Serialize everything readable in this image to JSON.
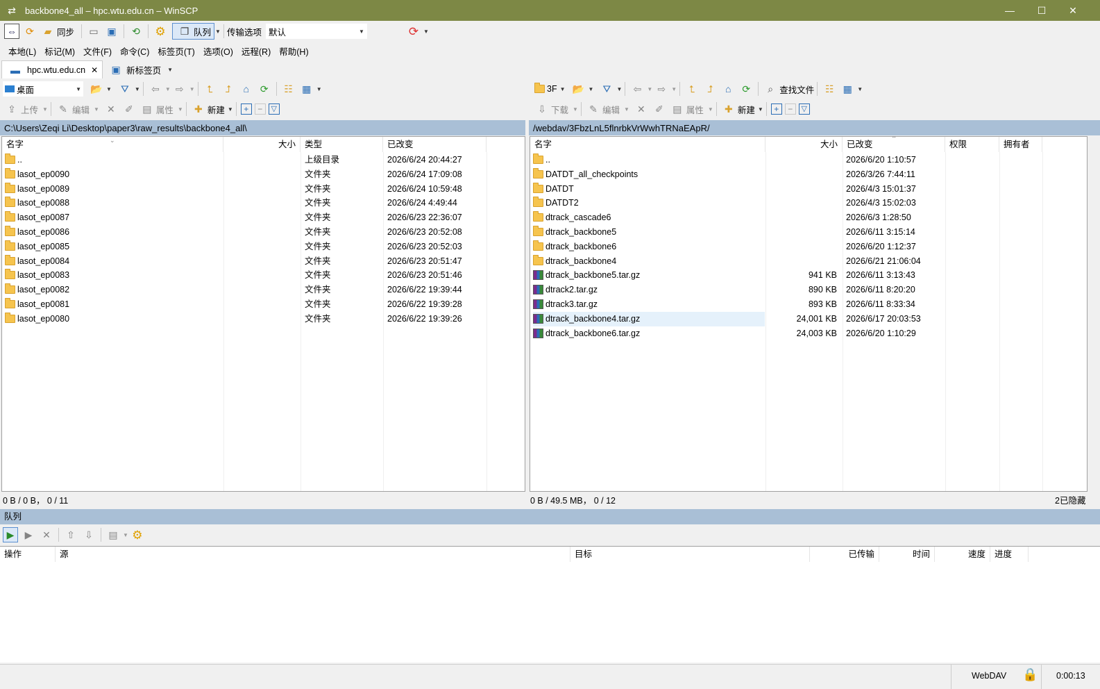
{
  "window": {
    "title": "backbone4_all – hpc.wtu.edu.cn – WinSCP",
    "minimize": "—",
    "maximize": "☐",
    "close": "✕"
  },
  "toolbar": {
    "sync_label": "同步",
    "queue_label": "队列",
    "transfer_label": "传输选项",
    "transfer_value": "默认"
  },
  "menu": [
    "本地(L)",
    "标记(M)",
    "文件(F)",
    "命令(C)",
    "标签页(T)",
    "选项(O)",
    "远程(R)",
    "帮助(H)"
  ],
  "tabs": {
    "session": "hpc.wtu.edu.cn",
    "close": "✕",
    "new_tab": "新标签页"
  },
  "local": {
    "location": "桌面",
    "actions": {
      "upload": "上传",
      "edit": "编辑",
      "properties": "属性",
      "new": "新建"
    },
    "path": "C:\\Users\\Zeqi Li\\Desktop\\paper3\\raw_results\\backbone4_all\\",
    "columns": {
      "name": "名字",
      "size": "大小",
      "type": "类型",
      "changed": "已改变"
    },
    "files": [
      {
        "name": "..",
        "size": "",
        "type": "上级目录",
        "changed": "2026/6/24 20:44:27",
        "kind": "parent"
      },
      {
        "name": "lasot_ep0090",
        "size": "",
        "type": "文件夹",
        "changed": "2026/6/24 17:09:08",
        "kind": "folder"
      },
      {
        "name": "lasot_ep0089",
        "size": "",
        "type": "文件夹",
        "changed": "2026/6/24 10:59:48",
        "kind": "folder"
      },
      {
        "name": "lasot_ep0088",
        "size": "",
        "type": "文件夹",
        "changed": "2026/6/24 4:49:44",
        "kind": "folder"
      },
      {
        "name": "lasot_ep0087",
        "size": "",
        "type": "文件夹",
        "changed": "2026/6/23 22:36:07",
        "kind": "folder"
      },
      {
        "name": "lasot_ep0086",
        "size": "",
        "type": "文件夹",
        "changed": "2026/6/23 20:52:08",
        "kind": "folder"
      },
      {
        "name": "lasot_ep0085",
        "size": "",
        "type": "文件夹",
        "changed": "2026/6/23 20:52:03",
        "kind": "folder"
      },
      {
        "name": "lasot_ep0084",
        "size": "",
        "type": "文件夹",
        "changed": "2026/6/23 20:51:47",
        "kind": "folder"
      },
      {
        "name": "lasot_ep0083",
        "size": "",
        "type": "文件夹",
        "changed": "2026/6/23 20:51:46",
        "kind": "folder"
      },
      {
        "name": "lasot_ep0082",
        "size": "",
        "type": "文件夹",
        "changed": "2026/6/22 19:39:44",
        "kind": "folder"
      },
      {
        "name": "lasot_ep0081",
        "size": "",
        "type": "文件夹",
        "changed": "2026/6/22 19:39:28",
        "kind": "folder"
      },
      {
        "name": "lasot_ep0080",
        "size": "",
        "type": "文件夹",
        "changed": "2026/6/22 19:39:26",
        "kind": "folder"
      }
    ],
    "status": "0 B / 0 B， 0 / 11"
  },
  "remote": {
    "location": "3F",
    "actions": {
      "download": "下载",
      "edit": "编辑",
      "properties": "属性",
      "new": "新建",
      "find": "查找文件"
    },
    "path": "/webdav/3FbzLnL5flnrbkVrWwhTRNaEApR/",
    "columns": {
      "name": "名字",
      "size": "大小",
      "changed": "已改变",
      "rights": "权限",
      "owner": "拥有者"
    },
    "files": [
      {
        "name": "..",
        "size": "",
        "changed": "2026/6/20 1:10:57",
        "kind": "parent"
      },
      {
        "name": "DATDT_all_checkpoints",
        "size": "",
        "changed": "2026/3/26 7:44:11",
        "kind": "folder"
      },
      {
        "name": "DATDT",
        "size": "",
        "changed": "2026/4/3 15:01:37",
        "kind": "folder"
      },
      {
        "name": "DATDT2",
        "size": "",
        "changed": "2026/4/3 15:02:03",
        "kind": "folder"
      },
      {
        "name": "dtrack_cascade6",
        "size": "",
        "changed": "2026/6/3 1:28:50",
        "kind": "folder"
      },
      {
        "name": "dtrack_backbone5",
        "size": "",
        "changed": "2026/6/11 3:15:14",
        "kind": "folder"
      },
      {
        "name": "dtrack_backbone6",
        "size": "",
        "changed": "2026/6/20 1:12:37",
        "kind": "folder"
      },
      {
        "name": "dtrack_backbone4",
        "size": "",
        "changed": "2026/6/21 21:06:04",
        "kind": "folder"
      },
      {
        "name": "dtrack_backbone5.tar.gz",
        "size": "941 KB",
        "changed": "2026/6/11 3:13:43",
        "kind": "archive"
      },
      {
        "name": "dtrack2.tar.gz",
        "size": "890 KB",
        "changed": "2026/6/11 8:20:20",
        "kind": "archive"
      },
      {
        "name": "dtrack3.tar.gz",
        "size": "893 KB",
        "changed": "2026/6/11 8:33:34",
        "kind": "archive"
      },
      {
        "name": "dtrack_backbone4.tar.gz",
        "size": "24,001 KB",
        "changed": "2026/6/17 20:03:53",
        "kind": "archive",
        "selected": true
      },
      {
        "name": "dtrack_backbone6.tar.gz",
        "size": "24,003 KB",
        "changed": "2026/6/20 1:10:29",
        "kind": "archive"
      }
    ],
    "status": "0 B / 49.5 MB， 0 / 12",
    "hidden": "2已隐藏"
  },
  "queue": {
    "title": "队列",
    "columns": {
      "operation": "操作",
      "source": "源",
      "target": "目标",
      "transferred": "已传输",
      "time": "时间",
      "speed": "速度",
      "progress": "进度"
    }
  },
  "statusbar": {
    "protocol": "WebDAV",
    "elapsed": "0:00:13"
  }
}
